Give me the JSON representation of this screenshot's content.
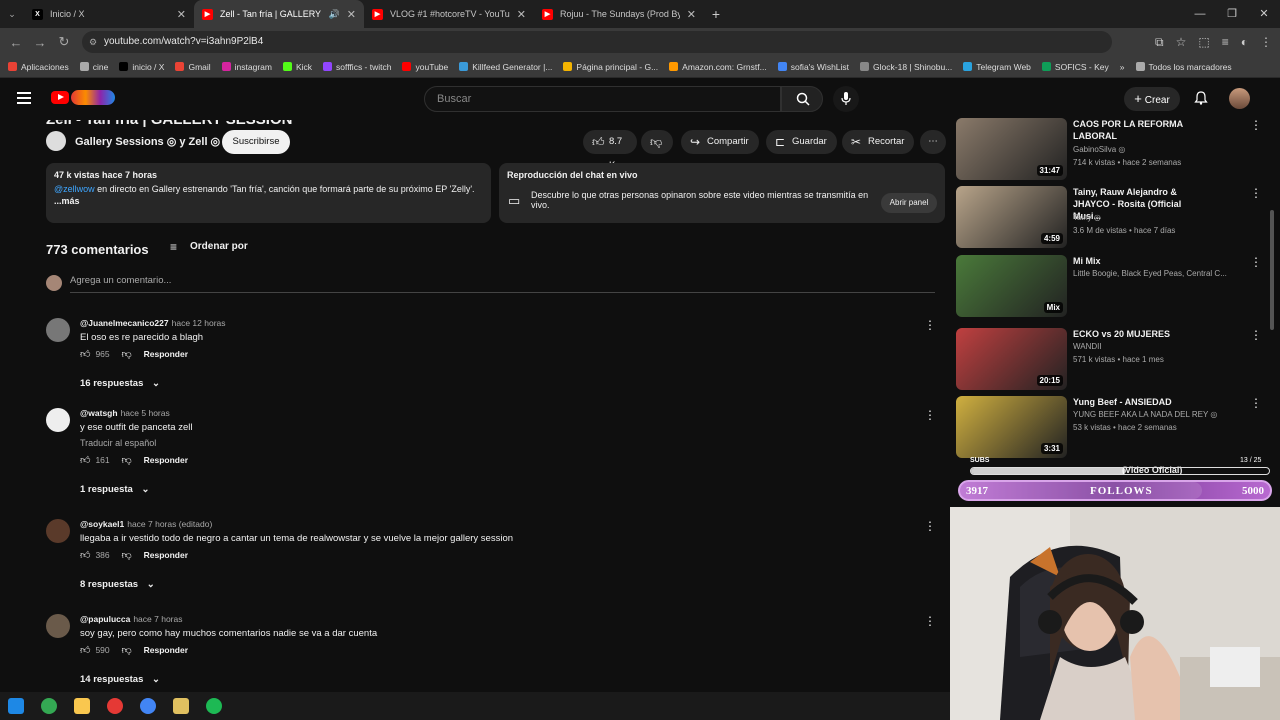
{
  "tabs": [
    {
      "label": "Inicio / X",
      "color": "#000000",
      "glyph": "X"
    },
    {
      "label": "Zell - Tan fría | GALLERY SE",
      "color": "#ff0000",
      "glyph": "▶"
    },
    {
      "label": "VLOG #1 #hotcoreTV - YouTub",
      "color": "#ff0000",
      "glyph": "▶"
    },
    {
      "label": "Rojuu - The Sundays (Prod By.",
      "color": "#ff0000",
      "glyph": "▶"
    }
  ],
  "url": "youtube.com/watch?v=i3ahn9P2lB4",
  "bookmarks": [
    {
      "label": "Aplicaciones",
      "color": "#e94235"
    },
    {
      "label": "cine",
      "color": "#aaaaaa"
    },
    {
      "label": "inicio / X",
      "color": "#000000"
    },
    {
      "label": "Gmail",
      "color": "#ea4335"
    },
    {
      "label": "instagram",
      "color": "#d6249f"
    },
    {
      "label": "Kick",
      "color": "#53fc18"
    },
    {
      "label": "sofffics - twitch",
      "color": "#9146ff"
    },
    {
      "label": "youTube",
      "color": "#ff0000"
    },
    {
      "label": "Killfeed Generator |...",
      "color": "#3a9ad9"
    },
    {
      "label": "Página principal - G...",
      "color": "#f4b400"
    },
    {
      "label": "Amazon.com: Grnstf...",
      "color": "#ff9900"
    },
    {
      "label": "sofia's WishList",
      "color": "#4285f4"
    },
    {
      "label": "Glock-18 | Shinobu...",
      "color": "#888888"
    },
    {
      "label": "Telegram Web",
      "color": "#2aa3df"
    },
    {
      "label": "SOFICS - Key",
      "color": "#0f9d58"
    }
  ],
  "bookmarks_all": "Todos los marcadores",
  "header": {
    "search_placeholder": "Buscar",
    "create_label": "Crear"
  },
  "video": {
    "title_cut": "Zell - Tan fría | GALLERY SESSION",
    "channel": "Gallery Sessions ◎ y Zell ◎",
    "subscribe": "Suscribirse",
    "likes": "8.7 K",
    "share": "Compartir",
    "save": "Guardar",
    "clip": "Recortar"
  },
  "description": {
    "meta": "47 k vistas  hace 7 horas",
    "mention": "@zellwow",
    "text": " en directo en Gallery estrenando 'Tan fría', canción que formará parte de su próximo EP 'Zelly'.",
    "more": "...más"
  },
  "chat": {
    "heading": "Reproducción del chat en vivo",
    "body": "Descubre lo que otras personas opinaron sobre este video mientras se transmitía en vivo.",
    "open_panel": "Abrir panel"
  },
  "comments_header": {
    "count": "773 comentarios",
    "sort": "Ordenar por",
    "add_placeholder": "Agrega un comentario..."
  },
  "comments": [
    {
      "user": "@Juanelmecanico227",
      "time": "hace 12 horas",
      "text": "El oso es re parecido a blagh",
      "likes": "965",
      "reply": "Responder",
      "replies": "16 respuestas",
      "translate": ""
    },
    {
      "user": "@watsgh",
      "time": "hace 5 horas",
      "text": "y ese outfit de panceta zell",
      "likes": "161",
      "reply": "Responder",
      "replies": "1 respuesta",
      "translate": "Traducir al español"
    },
    {
      "user": "@soykael1",
      "time": "hace 7 horas (editado)",
      "text": "llegaba a ir vestido todo de negro a cantar un tema de realwowstar y se vuelve la mejor gallery session",
      "likes": "386",
      "reply": "Responder",
      "replies": "8 respuestas",
      "translate": ""
    },
    {
      "user": "@papulucca",
      "time": "hace 7 horas",
      "text": "soy gay, pero como hay muchos comentarios nadie se va a dar cuenta",
      "likes": "590",
      "reply": "Responder",
      "replies": "14 respuestas",
      "translate": ""
    }
  ],
  "sidebar": [
    {
      "title": "CAOS POR LA REFORMA LABORAL",
      "channel": "GabinoSilva ◎",
      "stats": "714 k vistas • hace 2 semanas",
      "duration": "31:47",
      "color": "#8a7a6a"
    },
    {
      "title": "Tainy, Rauw Alejandro & JHAYCO - Rosita (Official Musi...",
      "channel": "Tainy ◎",
      "stats": "3.6 M de vistas • hace 7 días",
      "duration": "4:59",
      "color": "#b8a48a"
    },
    {
      "title": "Mi Mix",
      "channel": "Little Boogie, Black Eyed Peas, Central C...",
      "stats": "",
      "duration": "Mix",
      "color": "#4a7a3a"
    },
    {
      "title": "ECKO vs 20 MUJERES",
      "channel": "WANDII",
      "stats": "571 k vistas • hace 1 mes",
      "duration": "20:15",
      "color": "#c04040"
    },
    {
      "title": "Yung Beef - ANSIEDAD",
      "channel": "YUNG BEEF AKA LA NADA DEL REY ◎",
      "stats": "53 k vistas • hace 2 semanas",
      "duration": "3:31",
      "color": "#d0b040"
    }
  ],
  "partial_video_title": "(Video Oficial)",
  "follows": {
    "current": "3917",
    "label": "FOLLOWS",
    "goal": "5000",
    "progress": 0.78,
    "subs_label": "SUBS",
    "subs_count": "13 / 25"
  },
  "taskbar": [
    {
      "name": "windows-start-icon",
      "color": "#1e88e5"
    },
    {
      "name": "chrome-icon",
      "color": "#34a853"
    },
    {
      "name": "file-explorer-icon",
      "color": "#f9c74f"
    },
    {
      "name": "app-icon",
      "color": "#e53935"
    },
    {
      "name": "chrome-active-icon",
      "color": "#4285f4"
    },
    {
      "name": "app2-icon",
      "color": "#e0c060"
    },
    {
      "name": "spotify-icon",
      "color": "#1db954"
    }
  ]
}
